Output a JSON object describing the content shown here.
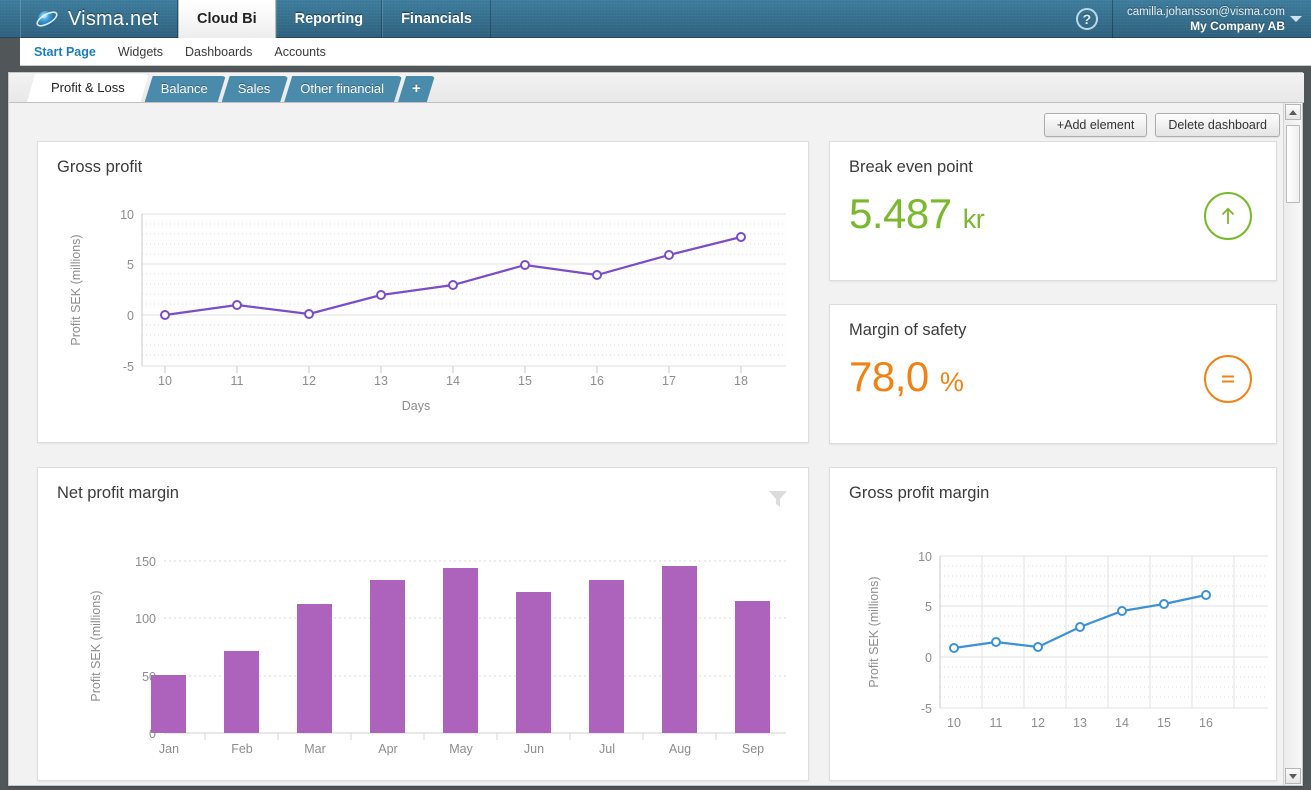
{
  "header": {
    "brand": "Visma.net",
    "brand_logo_icon": "visma-sphere-logo",
    "nav": [
      {
        "label": "Cloud Bi",
        "active": true
      },
      {
        "label": "Reporting",
        "active": false
      },
      {
        "label": "Financials",
        "active": false
      }
    ],
    "help_icon": "question-mark-icon",
    "help_label": "?",
    "user_email": "camilla.johansson@visma.com",
    "user_company": "My Company AB",
    "caret_icon": "chevron-down-icon"
  },
  "subnav": {
    "items": [
      {
        "label": "Start Page",
        "active": true
      },
      {
        "label": "Widgets",
        "active": false
      },
      {
        "label": "Dashboards",
        "active": false
      },
      {
        "label": "Accounts",
        "active": false
      }
    ]
  },
  "dashboard_tabs": {
    "items": [
      {
        "label": "Profit & Loss",
        "active": true
      },
      {
        "label": "Balance",
        "active": false
      },
      {
        "label": "Sales",
        "active": false
      },
      {
        "label": "Other financial",
        "active": false
      }
    ],
    "add_tab_label": "+",
    "add_tab_icon": "plus-icon"
  },
  "toolbar": {
    "add_element_label": "+Add element",
    "add_element_icon": "plus-icon",
    "delete_dashboard_label": "Delete dashboard"
  },
  "widgets": {
    "gross_profit": {
      "title": "Gross profit"
    },
    "break_even_point": {
      "title": "Break even point",
      "value": "5.487",
      "unit": "kr",
      "color": "#7ab82e",
      "trend_icon": "arrow-up-icon"
    },
    "margin_of_safety": {
      "title": "Margin of safety",
      "value": "78,0",
      "unit": "%",
      "color": "#f08215",
      "trend_icon": "equals-icon"
    },
    "net_profit_margin": {
      "title": "Net profit margin",
      "filter_icon": "funnel-filter-icon"
    },
    "gross_profit_margin": {
      "title": "Gross profit margin"
    }
  },
  "chart_data": [
    {
      "id": "gross-profit",
      "type": "line",
      "title": "Gross profit",
      "xlabel": "Days",
      "ylabel": "Profit SEK (millions)",
      "x": [
        10,
        11,
        12,
        13,
        14,
        15,
        16,
        17,
        18
      ],
      "xticks": [
        "10",
        "11",
        "12",
        "13",
        "14",
        "15",
        "16",
        "17",
        "18"
      ],
      "values": [
        0.0,
        1.0,
        0.1,
        2.0,
        3.0,
        4.9,
        4.0,
        5.9,
        7.7
      ],
      "yticks": [
        10,
        5,
        0,
        -5
      ],
      "ylim": [
        -5,
        10
      ],
      "color": "#7b4dc8",
      "grid": true,
      "legend": null
    },
    {
      "id": "net-profit-margin",
      "type": "bar",
      "title": "Net profit margin",
      "xlabel": "",
      "ylabel": "Profit SEK (millions)",
      "categories": [
        "Jan",
        "Feb",
        "Mar",
        "Apr",
        "May",
        "Jun",
        "Jul",
        "Aug",
        "Sep"
      ],
      "values": [
        51,
        72,
        113,
        134,
        145,
        124,
        134,
        146,
        116
      ],
      "yticks": [
        150,
        100,
        50,
        0
      ],
      "ylim": [
        0,
        160
      ],
      "color": "#ad63bc",
      "grid": true,
      "legend": null
    },
    {
      "id": "gross-profit-margin",
      "type": "line",
      "title": "Gross profit margin",
      "xlabel": "",
      "ylabel": "Profit SEK (millions)",
      "x": [
        10,
        11,
        12,
        13,
        14,
        15,
        16
      ],
      "xticks": [
        "10",
        "11",
        "12",
        "13",
        "14",
        "15",
        "16"
      ],
      "values": [
        0.9,
        1.5,
        1.0,
        3.0,
        4.5,
        5.2,
        6.1
      ],
      "yticks": [
        10,
        5,
        0,
        -5
      ],
      "ylim": [
        -5,
        10
      ],
      "color": "#3c92d4",
      "grid": true,
      "legend": null
    }
  ]
}
